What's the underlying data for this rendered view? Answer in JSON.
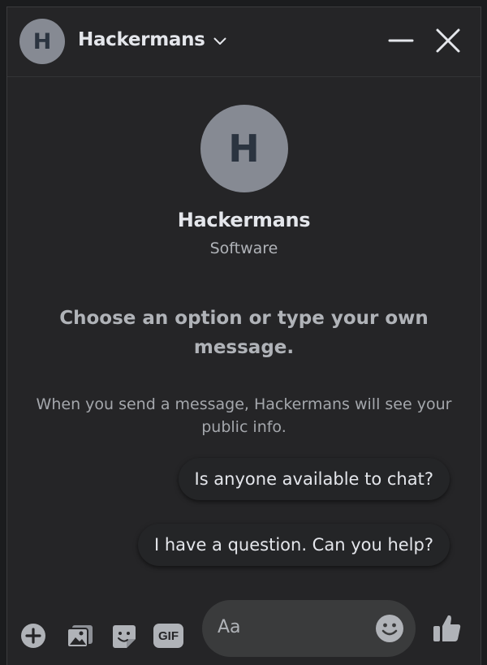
{
  "header": {
    "avatar_initial": "H",
    "title": "Hackermans",
    "icons": [
      "chevron-down-icon",
      "minimize-icon",
      "close-icon"
    ]
  },
  "profile": {
    "avatar_initial": "H",
    "name": "Hackermans",
    "category": "Software"
  },
  "prompt": "Choose an option or type your own message.",
  "note": "When you send a message, Hackermans will see your public info.",
  "options": [
    "Is anyone available to chat?",
    "I have a question. Can you help?"
  ],
  "composer": {
    "placeholder": "Aa",
    "gif_label": "GIF",
    "icons": [
      "plus-icon",
      "photo-icon",
      "sticker-icon",
      "gif-icon",
      "emoji-icon",
      "thumbs-up-icon"
    ]
  },
  "colors": {
    "background": "#252527",
    "text_primary": "#e4e6eb",
    "text_secondary": "#b0b3b8",
    "avatar": "#868a93",
    "input": "#3a3b3c"
  }
}
